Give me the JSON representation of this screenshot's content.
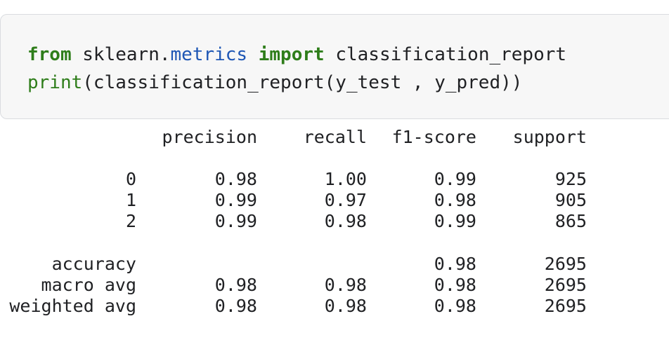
{
  "code": {
    "line1": {
      "kw_from": "from",
      "mod_pkg": " sklearn.",
      "mod_sub": "metrics",
      "kw_import": " import",
      "name": " classification_report"
    },
    "line2": {
      "fn_print": "print",
      "rest": "(classification_report(y_test , y_pred))"
    }
  },
  "report": {
    "headers": {
      "precision": "precision",
      "recall": "recall",
      "f1": "f1-score",
      "support": "support"
    },
    "rows": [
      {
        "label": "0",
        "precision": "0.98",
        "recall": "1.00",
        "f1": "0.99",
        "support": "925"
      },
      {
        "label": "1",
        "precision": "0.99",
        "recall": "0.97",
        "f1": "0.98",
        "support": "905"
      },
      {
        "label": "2",
        "precision": "0.99",
        "recall": "0.98",
        "f1": "0.99",
        "support": "865"
      }
    ],
    "summary": [
      {
        "label": "accuracy",
        "precision": "",
        "recall": "",
        "f1": "0.98",
        "support": "2695"
      },
      {
        "label": "macro avg",
        "precision": "0.98",
        "recall": "0.98",
        "f1": "0.98",
        "support": "2695"
      },
      {
        "label": "weighted avg",
        "precision": "0.98",
        "recall": "0.98",
        "f1": "0.98",
        "support": "2695"
      }
    ]
  }
}
